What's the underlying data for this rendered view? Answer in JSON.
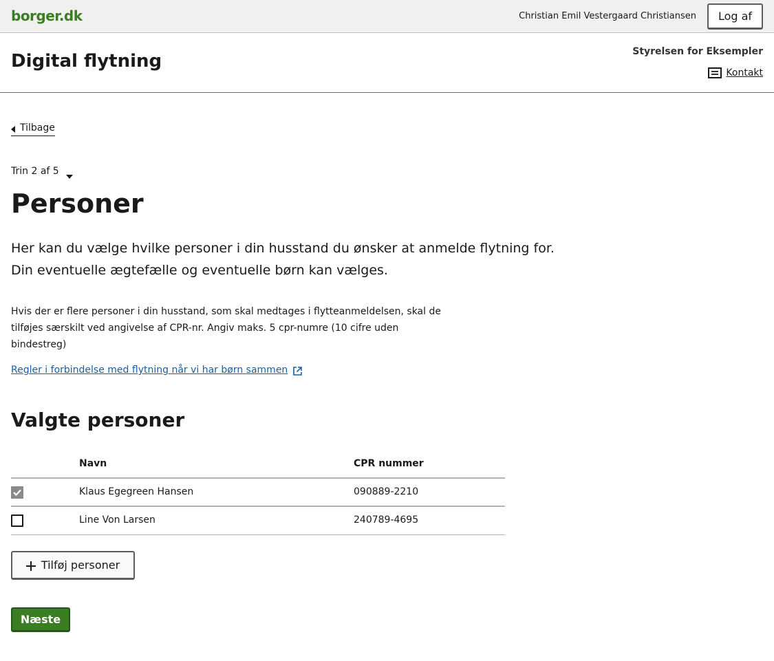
{
  "topbar": {
    "logo": "borger.dk",
    "user_name": "Christian Emil Vestergaard Christiansen",
    "logout_label": "Log af"
  },
  "header": {
    "title": "Digital flytning",
    "authority": "Styrelsen for Eksempler",
    "contact_label": "Kontakt",
    "contact_icon": "message-icon"
  },
  "nav": {
    "back_label": "Tilbage",
    "back_icon": "caret-left-icon"
  },
  "step": {
    "label": "Trin 2 af 5",
    "icon": "caret-down-icon"
  },
  "page": {
    "title": "Personer",
    "lead": "Her kan du vælge hvilke personer i din husstand du ønsker at anmelde flytning for. Din eventuelle ægtefælle og eventuelle børn kan vælges.",
    "body": "Hvis der er flere personer i din husstand, som skal medtages i flytteanmeldelsen, skal de tilføjes særskilt ved angivelse af CPR-nr. Angiv maks. 5 cpr-numre (10 cifre uden bindestreg)",
    "link_label": "Regler i forbindelse med flytning når vi har børn sammen",
    "link_icon": "external-link-icon"
  },
  "selected": {
    "title": "Valgte personer",
    "columns": [
      "Navn",
      "CPR nummer"
    ],
    "rows": [
      {
        "name": "Klaus Egegreen Hansen",
        "cpr": "090889-2210",
        "checked": true
      },
      {
        "name": "Line Von Larsen",
        "cpr": "240789-4695",
        "checked": false
      }
    ]
  },
  "actions": {
    "add_label": "Tilføj personer",
    "add_icon": "plus-icon",
    "next_label": "Næste"
  },
  "colors": {
    "brand_green": "#3b7d23",
    "link_blue": "#1a5fa0",
    "topbar_bg": "#f0f0f0"
  }
}
